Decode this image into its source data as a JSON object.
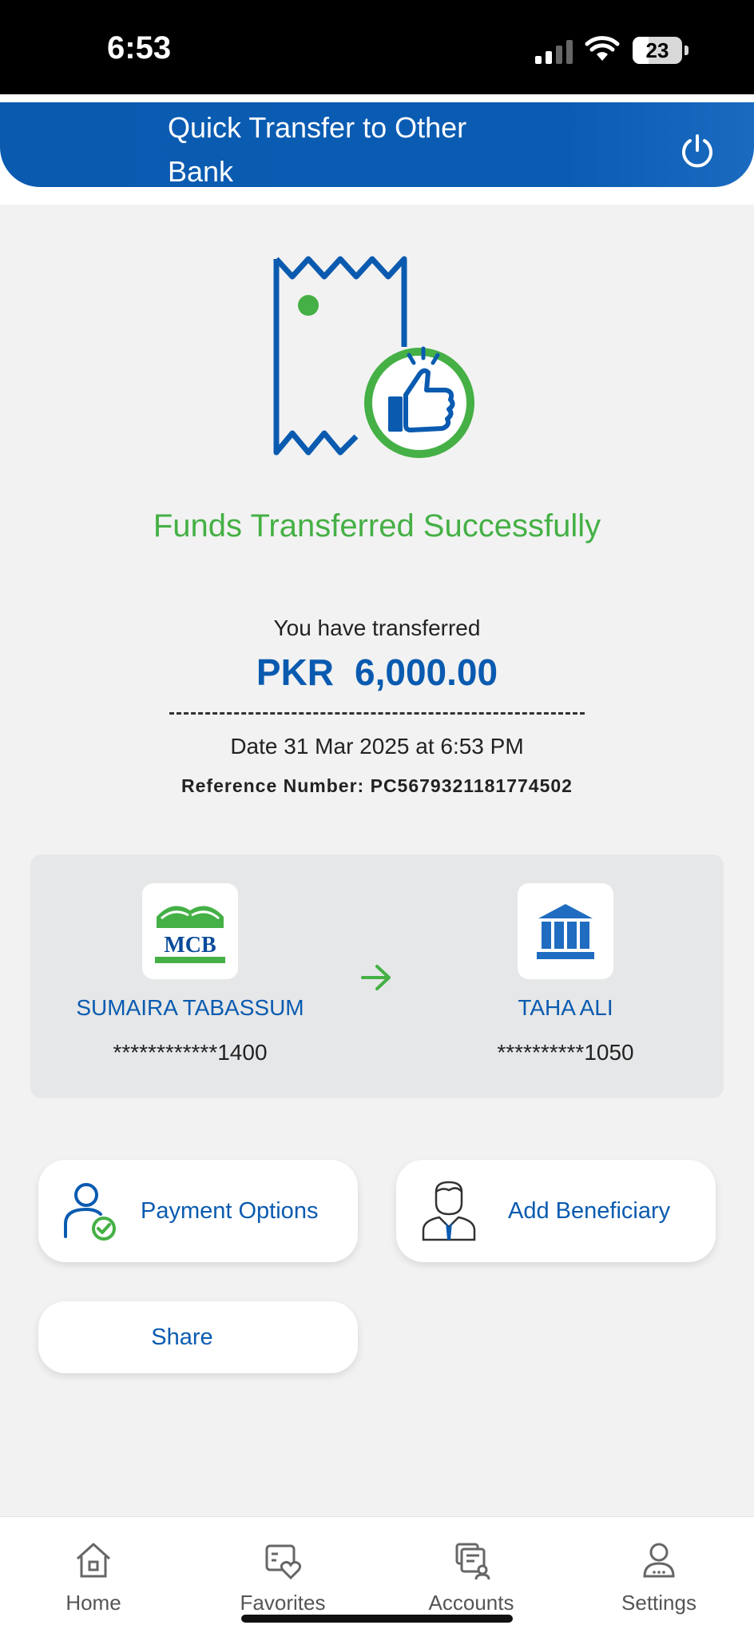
{
  "status_bar": {
    "time": "6:53",
    "battery": "23"
  },
  "header": {
    "title": "Quick Transfer to Other Bank",
    "power_icon": "power-icon"
  },
  "result": {
    "title": "Funds Transferred Successfully",
    "transfer_label": "You have transferred",
    "currency": "PKR",
    "amount": "6,000.00",
    "date": "Date 31 Mar 2025 at 6:53 PM",
    "reference": "Reference Number: PC5679321181774502"
  },
  "transfer": {
    "from": {
      "name": "SUMAIRA TABASSUM",
      "account": "************1400",
      "logo_text": "MCB"
    },
    "to": {
      "name": "TAHA ALI",
      "account": "**********1050"
    }
  },
  "actions": {
    "payment_options": "Payment Options",
    "add_beneficiary": "Add Beneficiary",
    "share": "Share"
  },
  "nav": {
    "home": "Home",
    "favorites": "Favorites",
    "accounts": "Accounts",
    "settings": "Settings"
  },
  "colors": {
    "brand_blue": "#0a5bb0",
    "success_green": "#45b045"
  }
}
